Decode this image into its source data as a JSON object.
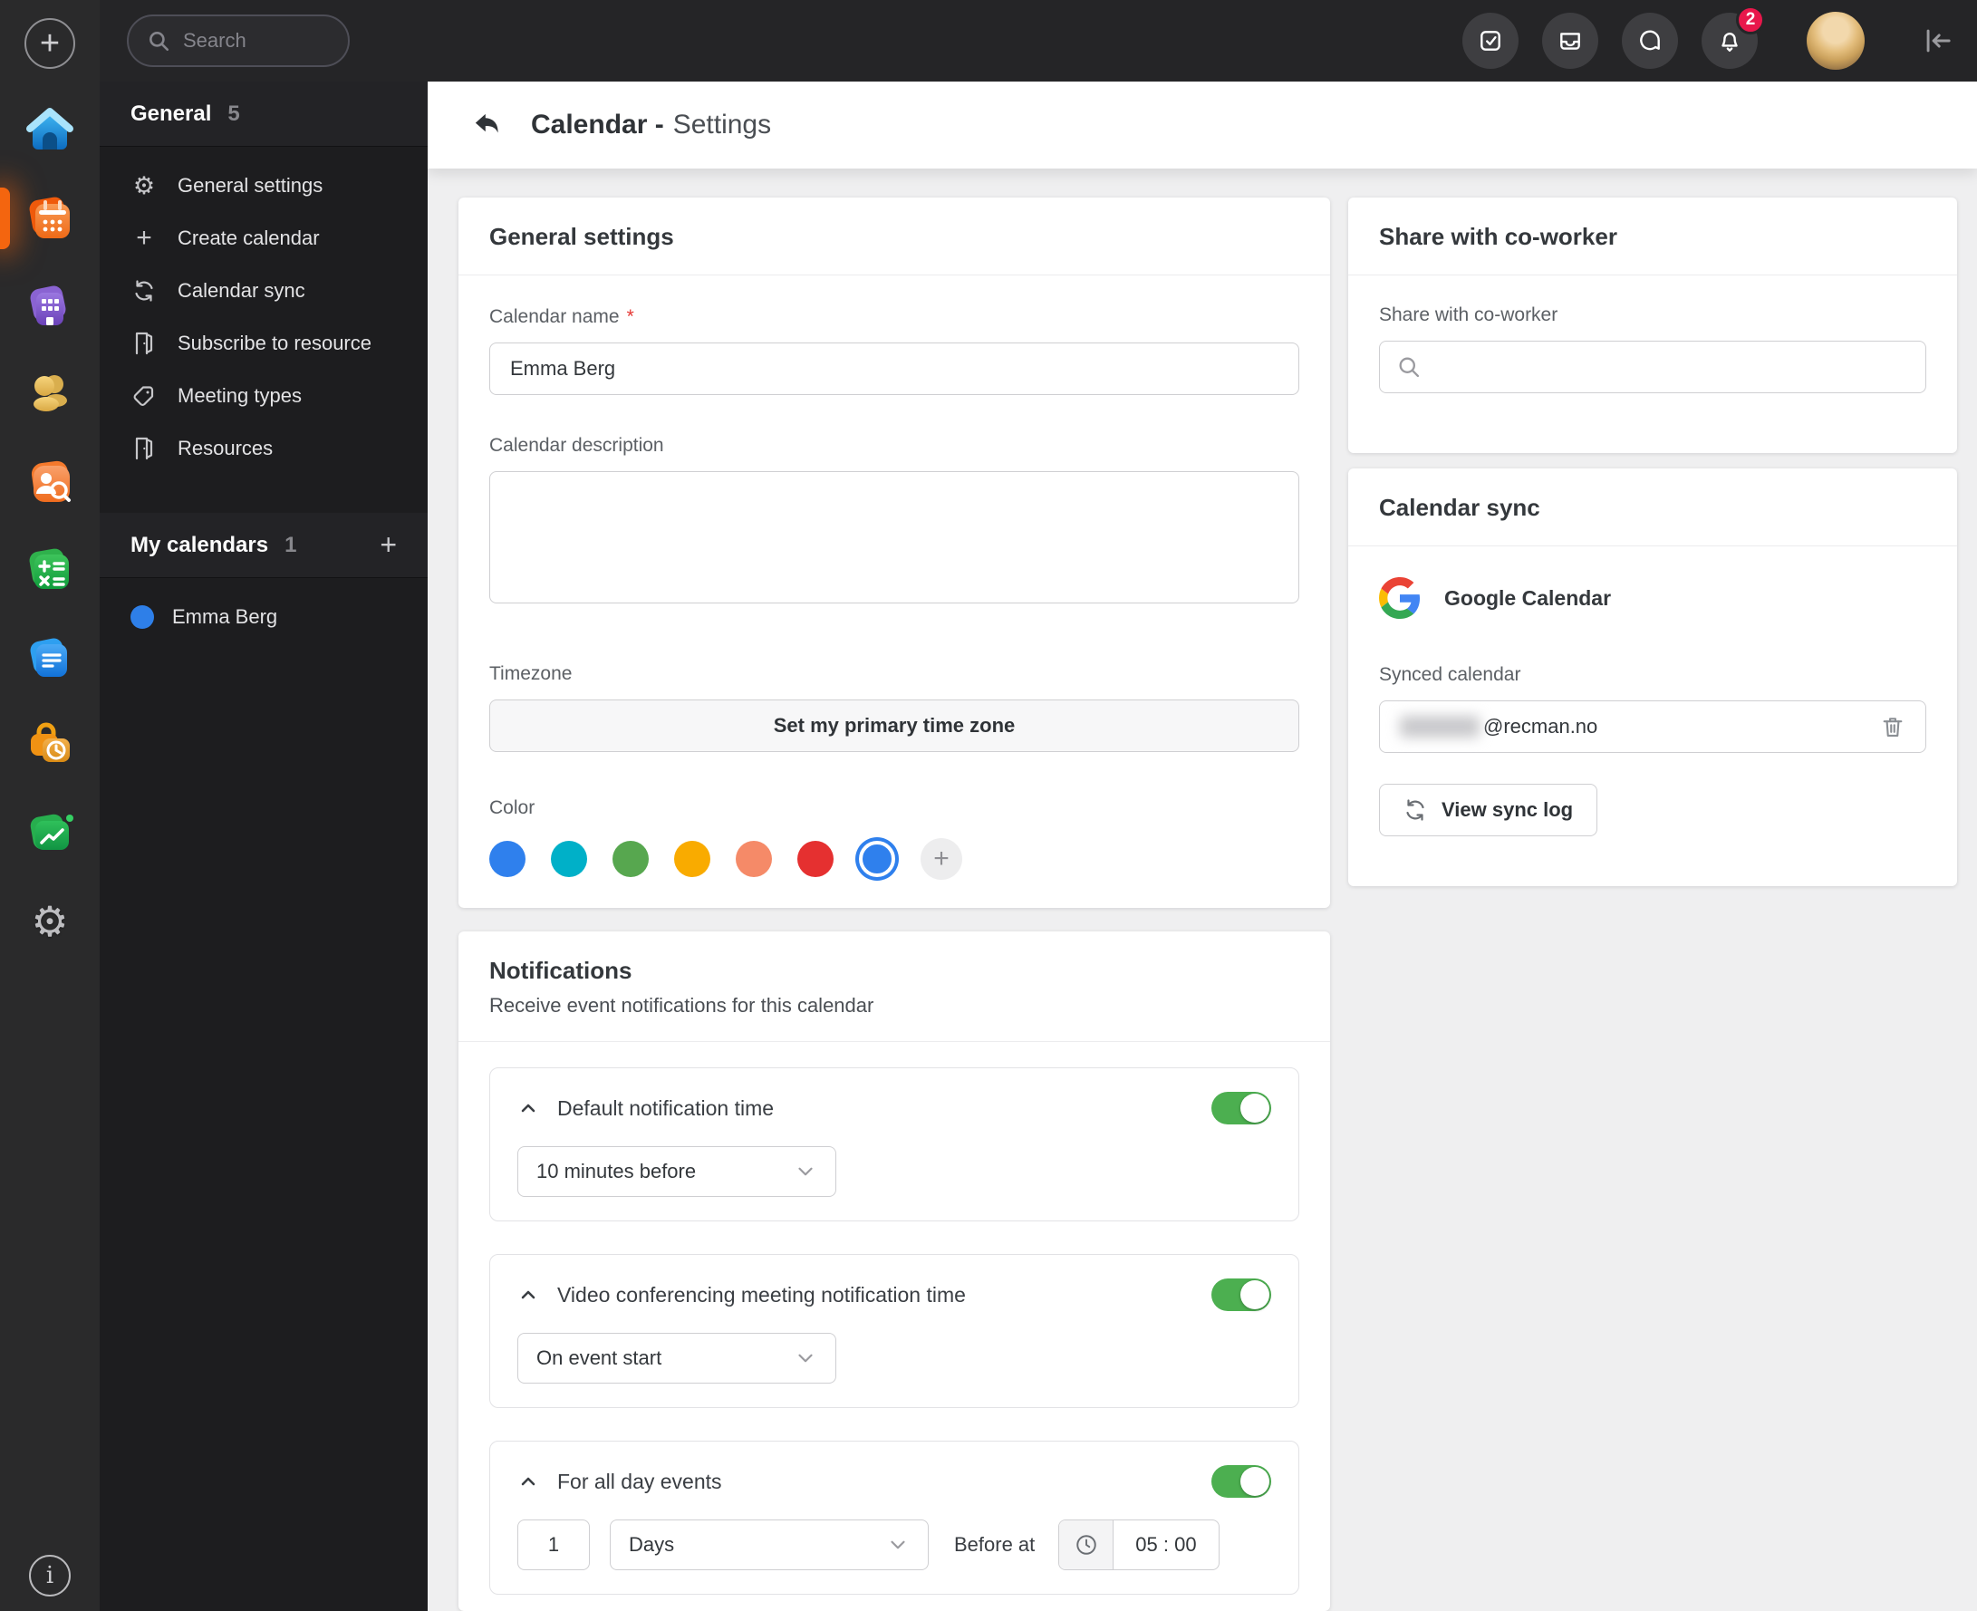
{
  "icons": {
    "add": "+",
    "info": "i",
    "plus_small": "+",
    "gear": "⚙"
  },
  "topbar": {
    "search_placeholder": "Search",
    "notification_count": "2"
  },
  "sidebar": {
    "general": {
      "label": "General",
      "count": "5"
    },
    "items": [
      {
        "label": "General settings",
        "icon": "gear-icon"
      },
      {
        "label": "Create calendar",
        "icon": "plus-icon"
      },
      {
        "label": "Calendar sync",
        "icon": "sync-icon"
      },
      {
        "label": "Subscribe to resource",
        "icon": "door-icon"
      },
      {
        "label": "Meeting types",
        "icon": "tag-icon"
      },
      {
        "label": "Resources",
        "icon": "door-icon"
      }
    ],
    "my_calendars": {
      "label": "My calendars",
      "count": "1"
    },
    "calendars": [
      {
        "name": "Emma Berg",
        "color": "#2e7fe8"
      }
    ]
  },
  "header": {
    "title_bold": "Calendar -",
    "title_light": "Settings"
  },
  "general_card": {
    "title": "General settings",
    "name_label": "Calendar name",
    "required_mark": "*",
    "name_value": "Emma Berg",
    "description_label": "Calendar description",
    "description_value": "",
    "timezone_label": "Timezone",
    "timezone_button": "Set my primary time zone",
    "color_label": "Color",
    "colors": [
      "#2f80ed",
      "#00b0c8",
      "#57a74f",
      "#f9ab00",
      "#f58a68",
      "#e53030",
      "#2f80ed"
    ],
    "selected_color_index": 6
  },
  "notifications_card": {
    "title": "Notifications",
    "subtitle": "Receive event notifications for this calendar",
    "sections": [
      {
        "label": "Default notification time",
        "enabled": true,
        "value": "10 minutes before"
      },
      {
        "label": "Video conferencing meeting notification time",
        "enabled": true,
        "value": "On event start"
      },
      {
        "label": "For all day events",
        "enabled": true,
        "number": "1",
        "unit": "Days",
        "before_at": "Before at",
        "time": "05 : 00"
      }
    ]
  },
  "share_card": {
    "title": "Share with co-worker",
    "label": "Share with co-worker",
    "search_value": ""
  },
  "sync_card": {
    "title": "Calendar sync",
    "provider": "Google Calendar",
    "synced_label": "Synced calendar",
    "synced_suffix": "@recman.no",
    "view_log": "View sync log"
  }
}
